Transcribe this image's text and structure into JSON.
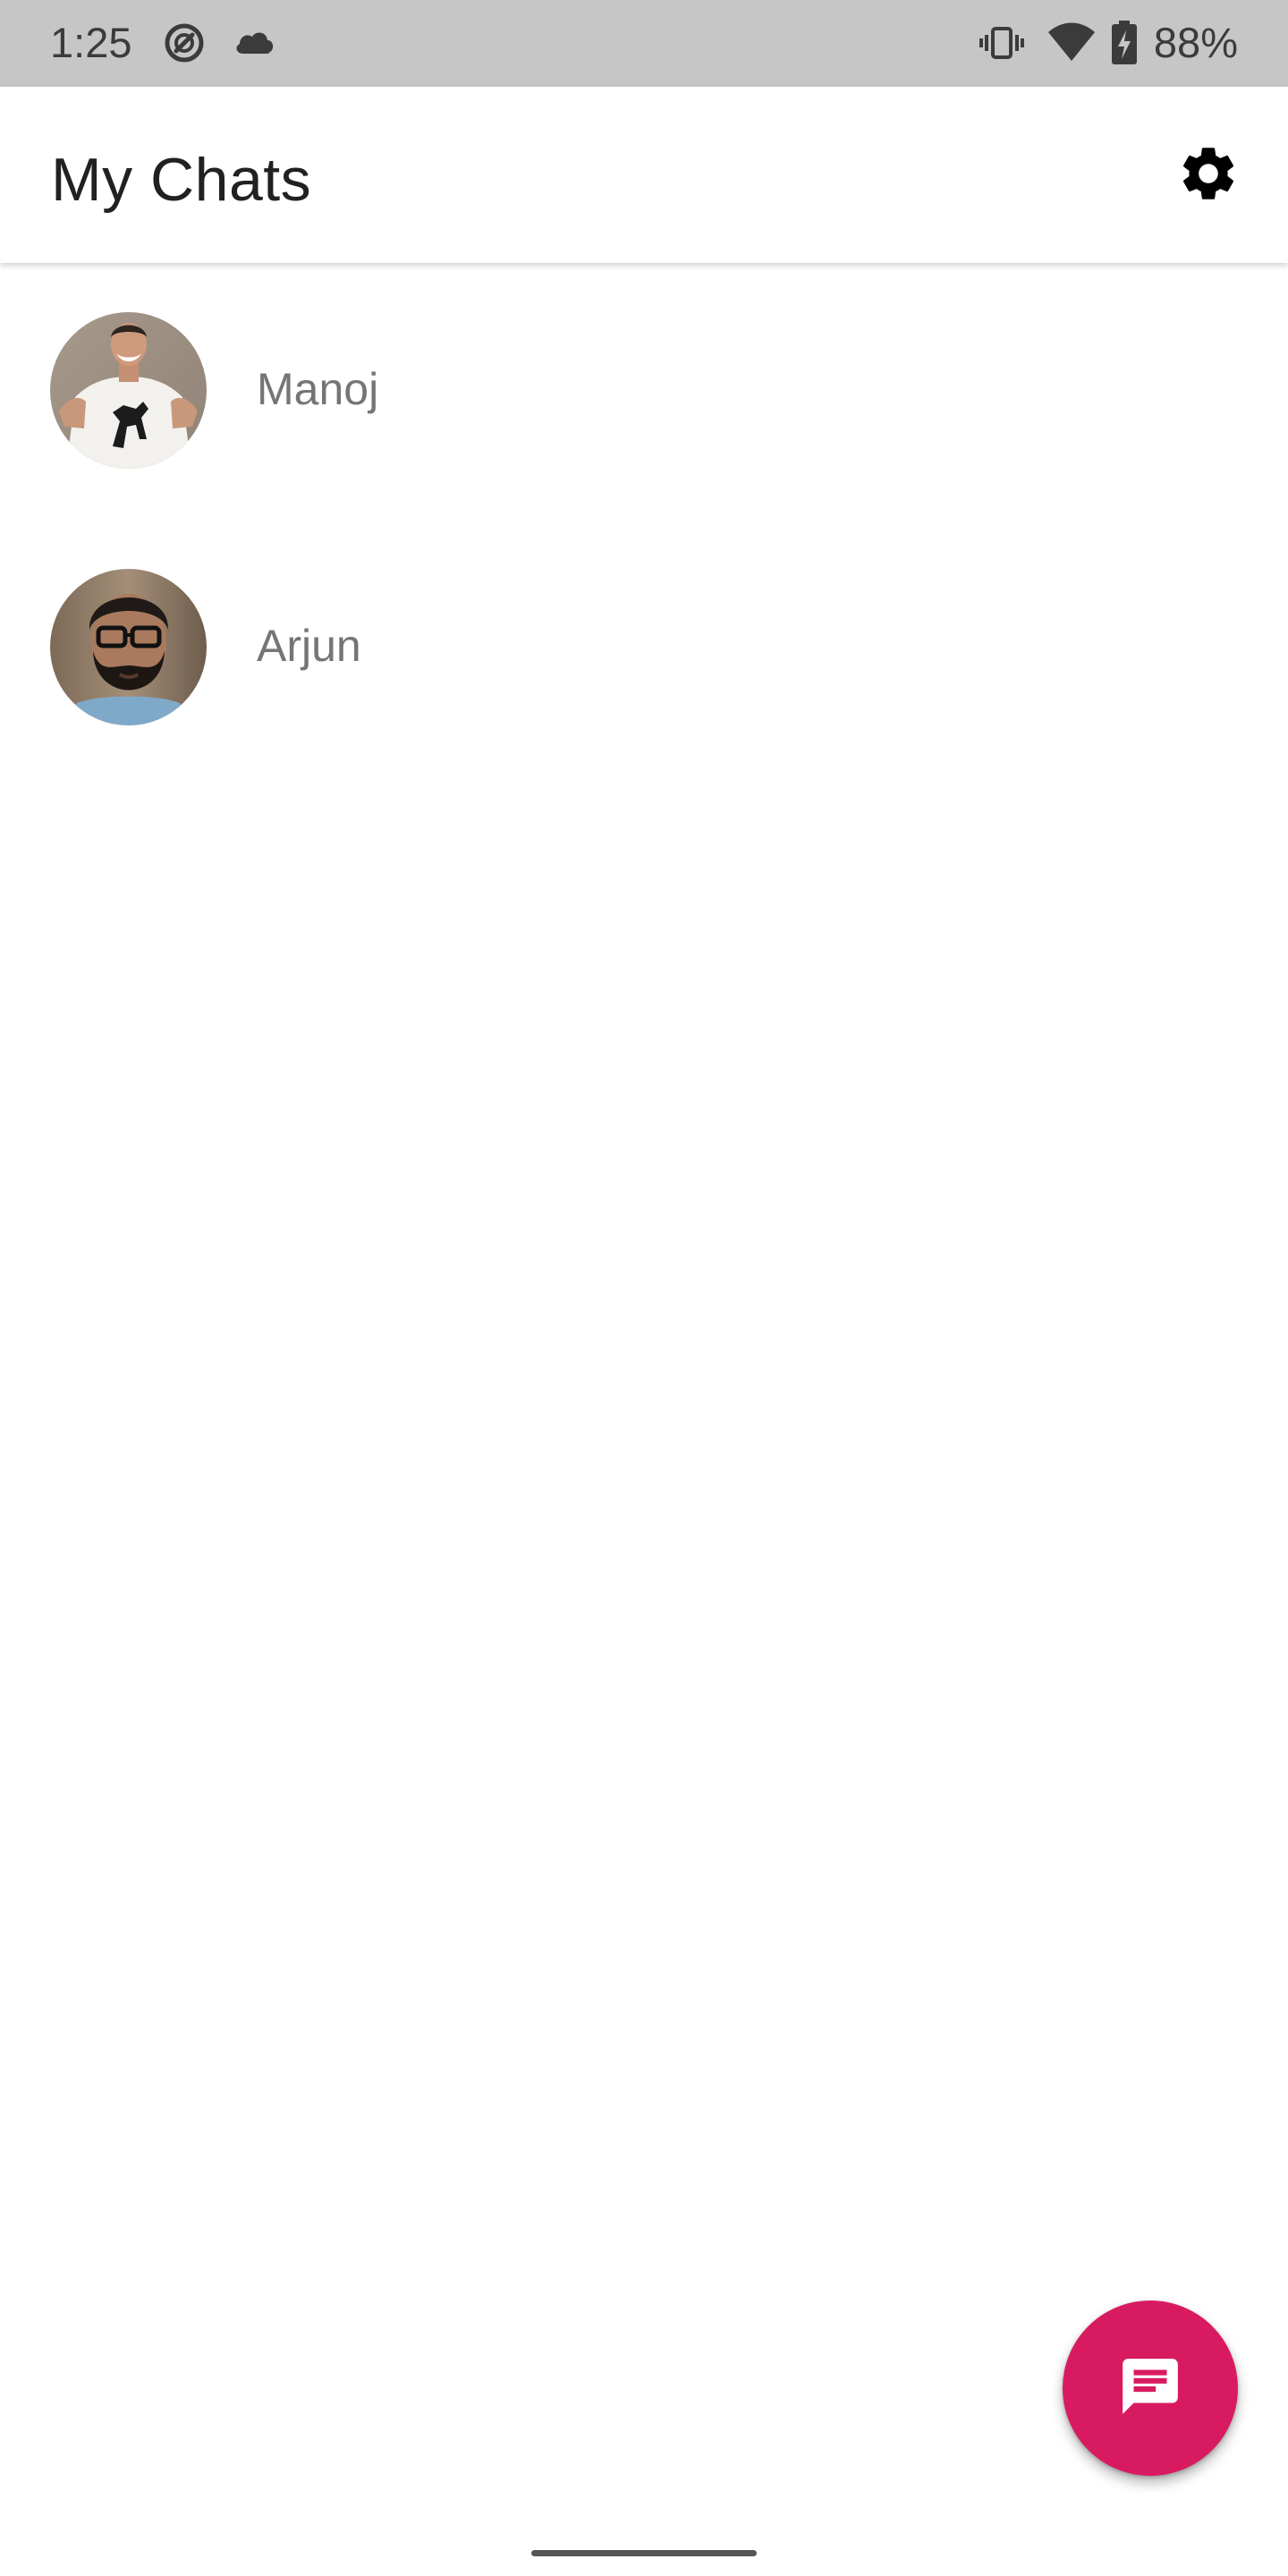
{
  "status_bar": {
    "time": "1:25",
    "left_icons": [
      "data-saver-icon",
      "cloud-icon"
    ],
    "right_icons": [
      "vibrate-icon",
      "wifi-icon",
      "battery-charging-icon"
    ],
    "battery_percent": "88%"
  },
  "app_bar": {
    "title": "My Chats",
    "settings_icon": "gear-icon"
  },
  "chats": [
    {
      "name": "Manoj",
      "avatar": "avatar-photo"
    },
    {
      "name": "Arjun",
      "avatar": "avatar-photo"
    }
  ],
  "fab": {
    "icon": "chat-bubble-icon"
  },
  "colors": {
    "status_bar_bg": "#c6c6c6",
    "accent": "#d81b60",
    "title_text": "#212121",
    "chat_name_text": "#757575"
  }
}
